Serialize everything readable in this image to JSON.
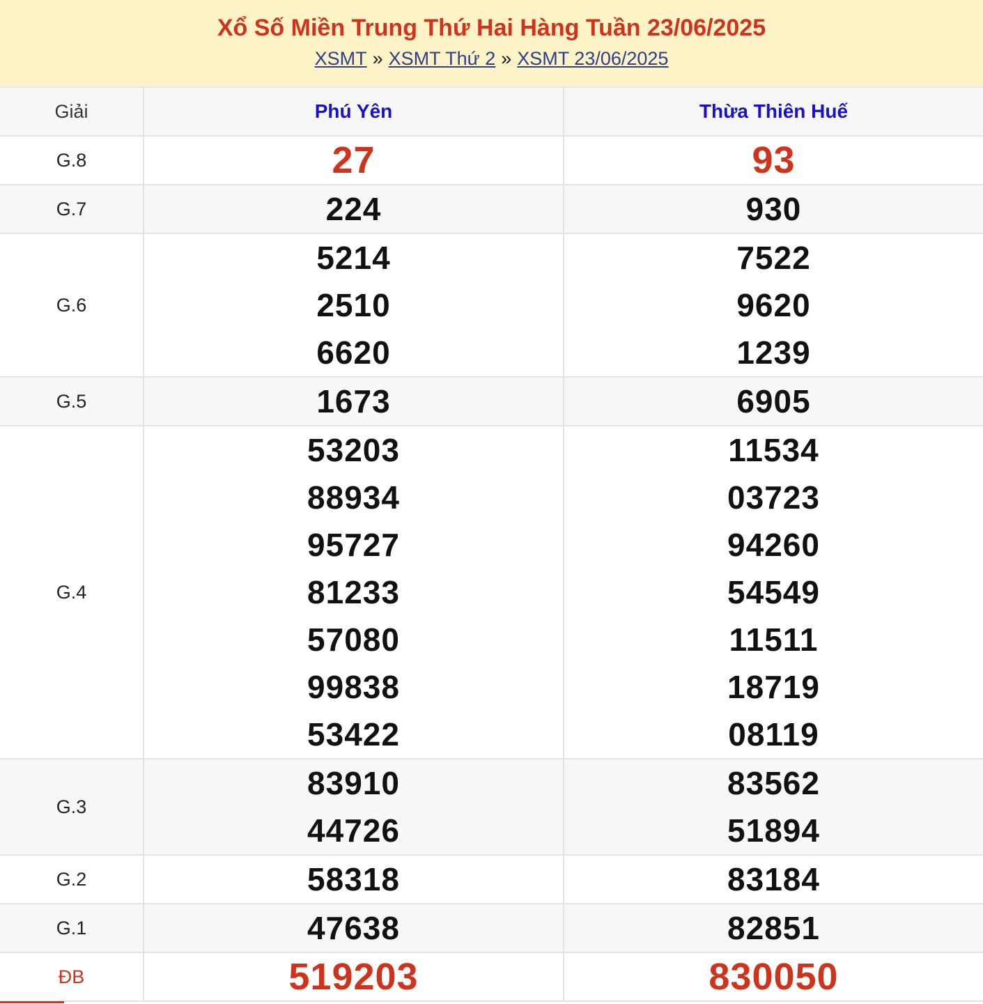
{
  "header": {
    "title": "Xổ Số Miền Trung Thứ Hai Hàng Tuần 23/06/2025",
    "breadcrumb": [
      {
        "label": "XSMT"
      },
      {
        "label": "XSMT Thứ 2"
      },
      {
        "label": "XSMT 23/06/2025"
      }
    ],
    "separator": "»"
  },
  "table": {
    "prize_header": "Giải",
    "provinces": [
      "Phú Yên",
      "Thừa Thiên Huế"
    ],
    "rows": [
      {
        "label": "G.8",
        "values": [
          [
            "27"
          ],
          [
            "93"
          ]
        ],
        "highlight": true
      },
      {
        "label": "G.7",
        "values": [
          [
            "224"
          ],
          [
            "930"
          ]
        ]
      },
      {
        "label": "G.6",
        "values": [
          [
            "5214",
            "2510",
            "6620"
          ],
          [
            "7522",
            "9620",
            "1239"
          ]
        ]
      },
      {
        "label": "G.5",
        "values": [
          [
            "1673"
          ],
          [
            "6905"
          ]
        ]
      },
      {
        "label": "G.4",
        "values": [
          [
            "53203",
            "88934",
            "95727",
            "81233",
            "57080",
            "99838",
            "53422"
          ],
          [
            "11534",
            "03723",
            "94260",
            "54549",
            "11511",
            "18719",
            "08119"
          ]
        ]
      },
      {
        "label": "G.3",
        "values": [
          [
            "83910",
            "44726"
          ],
          [
            "83562",
            "51894"
          ]
        ]
      },
      {
        "label": "G.2",
        "values": [
          [
            "58318"
          ],
          [
            "83184"
          ]
        ]
      },
      {
        "label": "G.1",
        "values": [
          [
            "47638"
          ],
          [
            "82851"
          ]
        ]
      },
      {
        "label": "ĐB",
        "values": [
          [
            "519203"
          ],
          [
            "830050"
          ]
        ],
        "highlight": true,
        "special": true
      }
    ]
  },
  "colors": {
    "accent_red": "#d0331c",
    "province_blue": "#1b0fc7",
    "link_blue": "#2b3f8c",
    "header_bg": "#fdf3c7"
  }
}
